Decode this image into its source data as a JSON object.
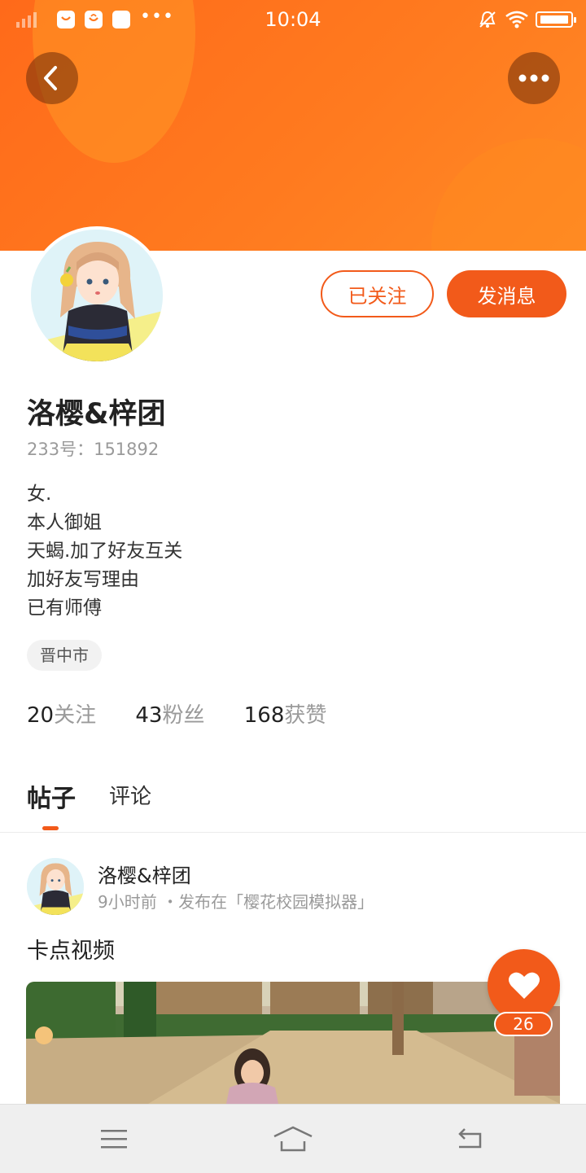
{
  "status_bar": {
    "time": "10:04",
    "icons": [
      "signal-icon",
      "notification-icon",
      "shopping-icon",
      "app-icon",
      "more-dots-icon",
      "silent-icon",
      "wifi-icon",
      "battery-icon"
    ]
  },
  "header": {
    "back_icon": "chevron-left-icon",
    "more_icon": "more-horizontal-icon",
    "gradient_start": "#ff6a1a",
    "gradient_end": "#ff8a25"
  },
  "profile": {
    "name": "洛樱&梓团",
    "id_text": "233号：151892",
    "bio": [
      "女.",
      "本人御姐",
      "天蝎.加了好友互关",
      "加好友写理由",
      "已有师傅"
    ],
    "location": "晋中市",
    "follow_button": "已关注",
    "message_button": "发消息",
    "stats": [
      {
        "value": "20",
        "label": "关注"
      },
      {
        "value": "43",
        "label": "粉丝"
      },
      {
        "value": "168",
        "label": "获赞"
      }
    ]
  },
  "tabs": [
    {
      "label": "帖子",
      "active": true
    },
    {
      "label": "评论",
      "active": false
    }
  ],
  "post": {
    "author": "洛樱&梓团",
    "meta": "9小时前 ・发布在「樱花校园模拟器」",
    "title": "卡点视频",
    "like_count": "26"
  },
  "accent_color": "#f25a1a",
  "navbar": {
    "icons": [
      "menu-icon",
      "home-icon",
      "back-icon"
    ]
  }
}
